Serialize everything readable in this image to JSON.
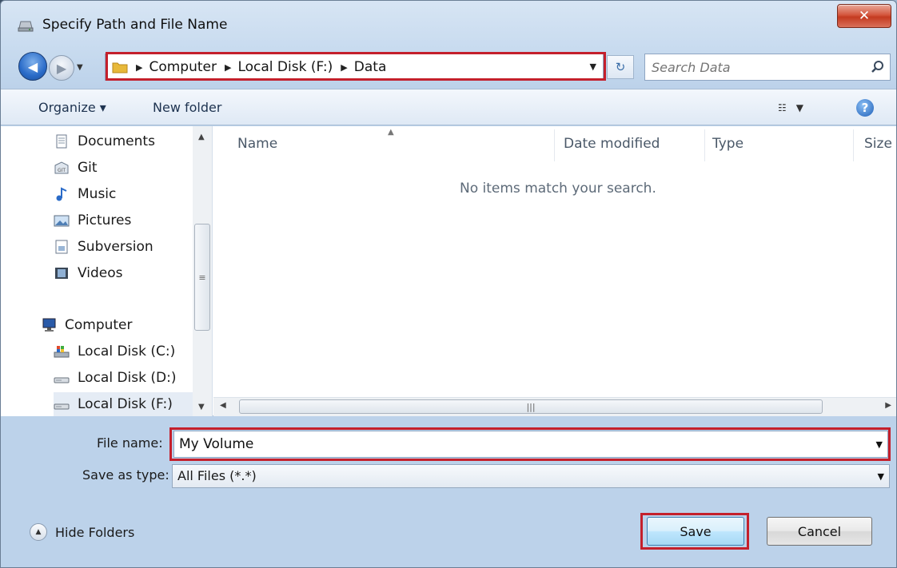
{
  "window": {
    "title": "Specify Path and File Name"
  },
  "address": {
    "crumbs": [
      "Computer",
      "Local Disk (F:)",
      "Data"
    ]
  },
  "search": {
    "placeholder": "Search Data"
  },
  "toolbar": {
    "organize": "Organize ▾",
    "new_folder": "New folder"
  },
  "nav": {
    "items": [
      {
        "label": "Documents",
        "icon": "documents-icon"
      },
      {
        "label": "Git",
        "icon": "git-icon"
      },
      {
        "label": "Music",
        "icon": "music-icon"
      },
      {
        "label": "Pictures",
        "icon": "pictures-icon"
      },
      {
        "label": "Subversion",
        "icon": "subversion-icon"
      },
      {
        "label": "Videos",
        "icon": "videos-icon"
      }
    ],
    "computer": "Computer",
    "drives": [
      "Local Disk (C:)",
      "Local Disk (D:)",
      "Local Disk (F:)"
    ]
  },
  "columns": {
    "name": "Name",
    "date": "Date modified",
    "type": "Type",
    "size": "Size"
  },
  "files": {
    "empty_message": "No items match your search."
  },
  "form": {
    "filename_label": "File name:",
    "filename_value": "My Volume",
    "type_label": "Save as type:",
    "type_value": "All Files (*.*)"
  },
  "footer": {
    "hide_folders": "Hide Folders",
    "save": "Save",
    "cancel": "Cancel"
  },
  "colors": {
    "highlight": "#c4202c",
    "accent": "#2a6bc8"
  }
}
